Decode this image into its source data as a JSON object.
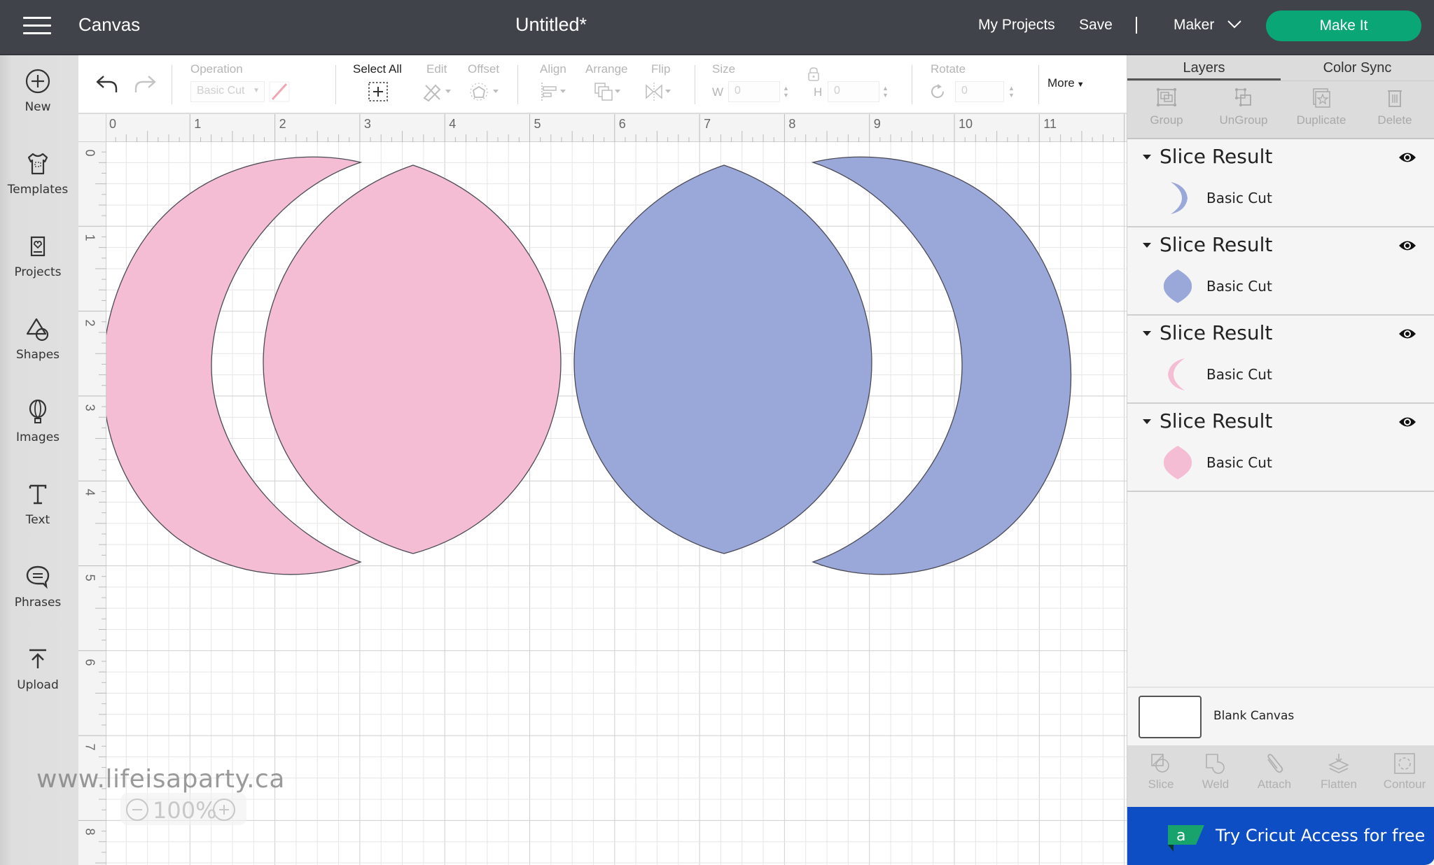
{
  "header": {
    "app_title": "Canvas",
    "doc_title": "Untitled*",
    "my_projects": "My Projects",
    "save": "Save",
    "machine": "Maker",
    "make_it": "Make It"
  },
  "sidebar": {
    "items": [
      {
        "label": "New",
        "icon": "plus-circle-icon"
      },
      {
        "label": "Templates",
        "icon": "tshirt-icon"
      },
      {
        "label": "Projects",
        "icon": "card-heart-icon"
      },
      {
        "label": "Shapes",
        "icon": "shapes-icon"
      },
      {
        "label": "Images",
        "icon": "balloon-icon"
      },
      {
        "label": "Text",
        "icon": "text-t-icon"
      },
      {
        "label": "Phrases",
        "icon": "speech-bubble-icon"
      },
      {
        "label": "Upload",
        "icon": "upload-icon"
      }
    ]
  },
  "toolbar": {
    "operation_label": "Operation",
    "operation_value": "Basic Cut",
    "select_all": "Select All",
    "edit": "Edit",
    "offset": "Offset",
    "align": "Align",
    "arrange": "Arrange",
    "flip": "Flip",
    "size": "Size",
    "w_label": "W",
    "w_value": "0",
    "h_label": "H",
    "h_value": "0",
    "rotate": "Rotate",
    "rotate_value": "0",
    "more": "More"
  },
  "canvas": {
    "ruler_h": [
      "0",
      "1",
      "2",
      "3",
      "4",
      "5",
      "6",
      "7",
      "8",
      "9",
      "10",
      "11"
    ],
    "ruler_v": [
      "0",
      "1",
      "2",
      "3",
      "4",
      "5",
      "6",
      "7",
      "8"
    ],
    "watermark": "www.lifeisaparty.ca",
    "zoom": "100%",
    "colors": {
      "pink": "#f4bdd4",
      "blue": "#9aa7d9",
      "stroke": "#4a4a55"
    }
  },
  "panel": {
    "tabs": [
      "Layers",
      "Color Sync"
    ],
    "actions": [
      "Group",
      "UnGroup",
      "Duplicate",
      "Delete"
    ],
    "layers": [
      {
        "title": "Slice Result",
        "sub": "Basic Cut",
        "shape": "crescent-right",
        "color": "#9aa7d9"
      },
      {
        "title": "Slice Result",
        "sub": "Basic Cut",
        "shape": "lens",
        "color": "#9aa7d9"
      },
      {
        "title": "Slice Result",
        "sub": "Basic Cut",
        "shape": "crescent-left",
        "color": "#f4bdd4"
      },
      {
        "title": "Slice Result",
        "sub": "Basic Cut",
        "shape": "lens",
        "color": "#f4bdd4"
      }
    ],
    "blank_canvas": "Blank Canvas",
    "bottom_actions": [
      "Slice",
      "Weld",
      "Attach",
      "Flatten",
      "Contour"
    ],
    "banner": "Try Cricut Access for free",
    "banner_color": "#0e4ec4"
  }
}
